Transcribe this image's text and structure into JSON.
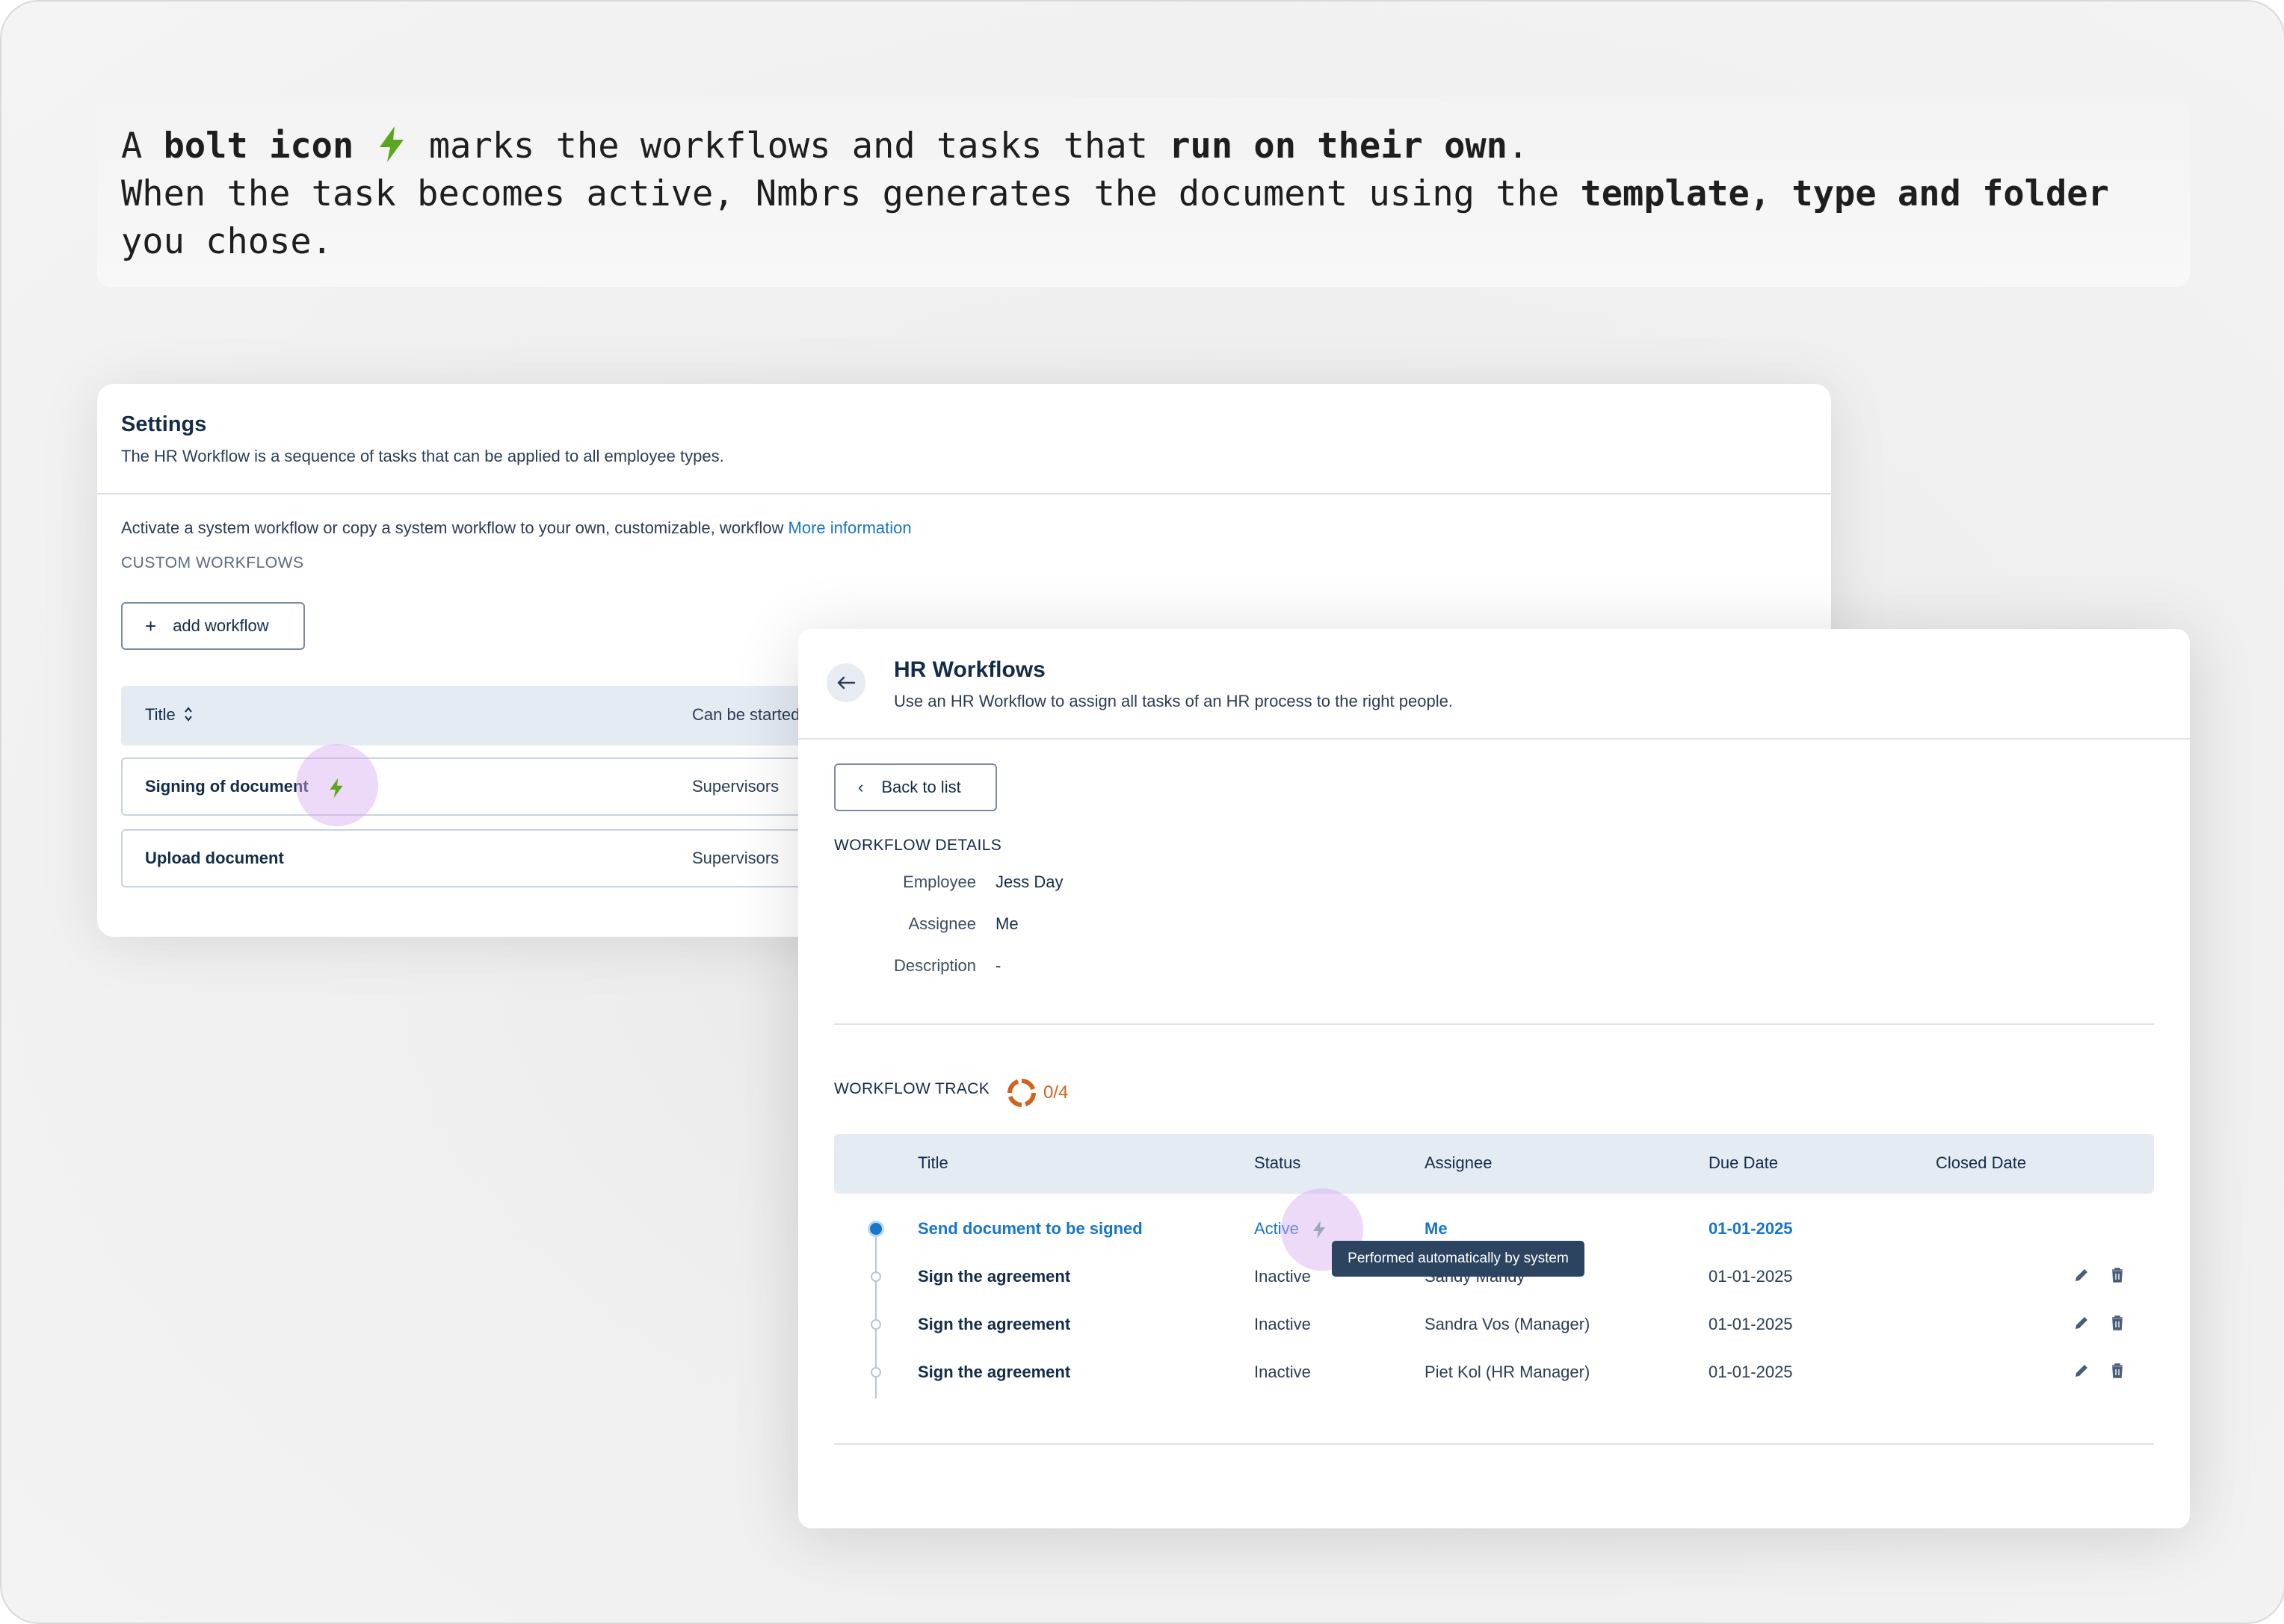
{
  "intro": {
    "l1_a": "A ",
    "l1_b": "bolt icon",
    "l1_c": " marks the workflows and tasks that ",
    "l1_d": "run on their own",
    "l1_e": ".",
    "l2_a": "When the task becomes active, Nmbrs generates the document using the ",
    "l2_b": "template, type and folder",
    "l3": "you chose."
  },
  "settings": {
    "title": "Settings",
    "subtitle": "The HR Workflow is a sequence of tasks that can be applied to all employee types.",
    "activate_text": "Activate a system workflow or copy a system workflow to your own, customizable, workflow",
    "more_info": "More information",
    "custom_label": "CUSTOM WORKFLOWS",
    "add_button": "add workflow",
    "columns": {
      "title": "Title",
      "can_be_started": "Can be started"
    },
    "rows": [
      {
        "title": "Signing of document",
        "started_by": "Supervisors",
        "automated": true
      },
      {
        "title": "Upload document",
        "started_by": "Supervisors",
        "automated": false
      }
    ]
  },
  "hr": {
    "title": "HR Workflows",
    "subtitle": "Use an HR Workflow to assign all tasks of an HR process to the right people.",
    "back_button": "Back to list",
    "details_label": "WORKFLOW DETAILS",
    "details": [
      {
        "label": "Employee",
        "value": "Jess Day"
      },
      {
        "label": "Assignee",
        "value": "Me"
      },
      {
        "label": "Description",
        "value": "-"
      }
    ],
    "track_label": "WORKFLOW TRACK",
    "progress": "0/4",
    "columns": {
      "title": "Title",
      "status": "Status",
      "assignee": "Assignee",
      "due_date": "Due Date",
      "closed_date": "Closed Date"
    },
    "tasks": [
      {
        "title": "Send document to be signed",
        "status": "Active",
        "assignee": "Me",
        "due": "01-01-2025",
        "active": true
      },
      {
        "title": "Sign the agreement",
        "status": "Inactive",
        "assignee": "Sandy Mandy",
        "due": "01-01-2025",
        "active": false
      },
      {
        "title": "Sign the agreement",
        "status": "Inactive",
        "assignee": "Sandra Vos (Manager)",
        "due": "01-01-2025",
        "active": false
      },
      {
        "title": "Sign the agreement",
        "status": "Inactive",
        "assignee": "Piet Kol (HR Manager)",
        "due": "01-01-2025",
        "active": false
      }
    ],
    "tooltip": "Performed automatically by system"
  },
  "colors": {
    "bolt_green": "#5aa61e",
    "accent_blue": "#1776c8",
    "progress_orange": "#d2631d",
    "highlight_halo": "#d6aaf0"
  },
  "icons": [
    "bolt-icon",
    "sort-icon",
    "plus-icon",
    "back-arrow-icon",
    "chevron-left-icon",
    "progress-ring-icon",
    "edit-icon",
    "delete-icon"
  ]
}
